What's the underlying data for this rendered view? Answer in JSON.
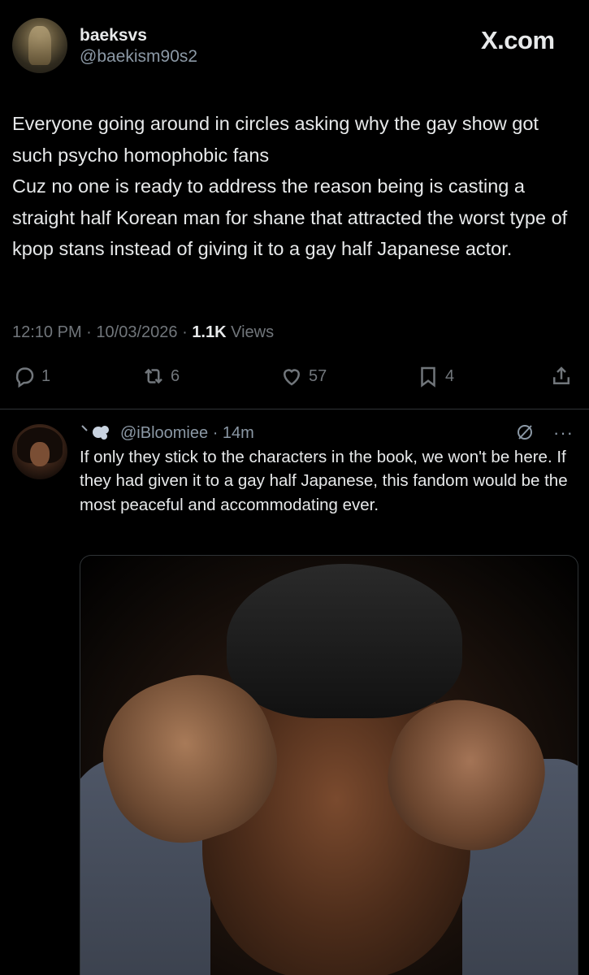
{
  "header": {
    "display_name": "baeksvs",
    "handle": "@baekism90s2",
    "site_logo": "X.com"
  },
  "tweet": {
    "text": "Everyone going around in circles asking why the gay show got such psycho homophobic fans\nCuz no one is ready to address the reason being is casting a straight half Korean man for shane that attracted the worst type of kpop stans instead of giving it to a gay half Japanese actor.",
    "time": "12:10 PM",
    "date": "10/03/2026",
    "views_count": "1.1K",
    "views_label": "Views",
    "separator": "·"
  },
  "actions": {
    "replies": "1",
    "reposts": "6",
    "likes": "57",
    "bookmarks": "4"
  },
  "reply": {
    "handle": "@iBloomiee",
    "time": "14m",
    "separator": "·",
    "text": "If only they stick to the characters in the book, we won't be here. If they had given it to a gay half Japanese, this fandom would be the most peaceful and accommodating ever.",
    "more": "···"
  },
  "colors": {
    "background": "#000000",
    "text": "#e7e9ea",
    "secondary": "#71767b",
    "divider": "#2f3336"
  }
}
